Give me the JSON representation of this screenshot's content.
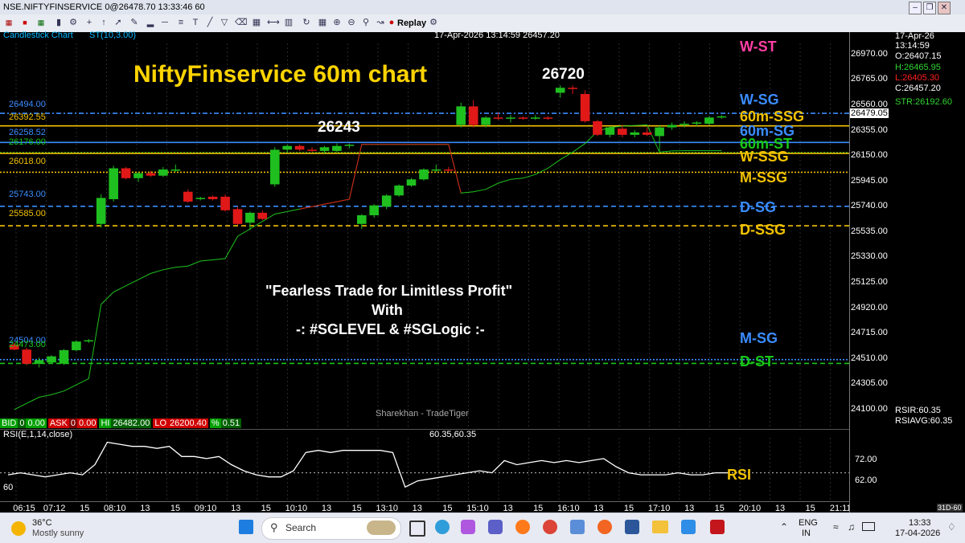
{
  "window": {
    "title": "NSE.NIFTYFINSERVICE 0@26478.70 13:33:46 60"
  },
  "toolbar": {
    "replay_label": "Replay"
  },
  "chart_header": {
    "type_label": "Candlestick Chart",
    "indicator_label": "ST(10,3.00)",
    "datetime_info": "17-Apr-2026 13:14:59 26457.20"
  },
  "overlay": {
    "title": "NiftyFinservice 60m chart",
    "high_label": "26720",
    "swing_label": "26243",
    "slogan_1": "\"Fearless Trade for Limitless Profit\"",
    "slogan_2": "With",
    "slogan_3": "-: #SGLEVEL & #SGLogic :-",
    "watermark": "Sharekhan - TradeTiger"
  },
  "info_panel": {
    "date": "17-Apr-26",
    "time": "13:14:59",
    "open": "O:26407.15",
    "high": "H:26465.95",
    "low": "L:26405.30",
    "close": "C:26457.20",
    "str": "STR:26192.60"
  },
  "quote_bar": {
    "bid_label": "BID",
    "bid_qty": "0",
    "bid_price": "0.00",
    "ask_label": "ASK",
    "ask_qty": "0",
    "ask_price": "0.00",
    "hi_label": "HI",
    "hi_value": "26482.00",
    "lo_label": "LO",
    "lo_value": "26200.40",
    "pct_label": "%",
    "pct_value": "0.51"
  },
  "rsi_panel": {
    "title": "RSI(E,1,14,close)",
    "values_text": "60.35,60.35",
    "rsir": "RSIR:60.35",
    "rsiavg": "RSIAVG:60.35",
    "tick_72": "72.00",
    "tick_62": "62.00",
    "left_level": "60",
    "annotation": "RSI",
    "corner": "31D-60"
  },
  "price_axis_ticks": [
    "26970.00",
    "26765.00",
    "26560.00",
    "26355.00",
    "26150.00",
    "25945.00",
    "25740.00",
    "25535.00",
    "25330.00",
    "25125.00",
    "24920.00",
    "24715.00",
    "24510.00",
    "24305.00",
    "24100.00"
  ],
  "current_price_tag": "26479.05",
  "x_axis": {
    "labels": [
      "06:15",
      "07:12",
      "15",
      "08:10",
      "13",
      "15",
      "09:10",
      "13",
      "15",
      "10:10",
      "13",
      "15",
      "13:10",
      "13",
      "15",
      "15:10",
      "13",
      "15",
      "16:10",
      "13",
      "15",
      "17:10",
      "13",
      "15",
      "20:10",
      "13",
      "15",
      "21:11"
    ]
  },
  "levels": [
    {
      "label": "W-ST",
      "value_text": "",
      "color": "#ff3fa4"
    },
    {
      "label": "W-SG",
      "value_text": "26494.00",
      "color": "#3a8cff"
    },
    {
      "label": "60m-SSG",
      "value_text": "26392.55",
      "color": "#f2c200"
    },
    {
      "label": "60m-SG",
      "value_text": "26258.52",
      "color": "#3a8cff"
    },
    {
      "label": "60m-ST",
      "value_text": "26176.00",
      "color": "#18c718"
    },
    {
      "label": "W-SSG",
      "value_text": "",
      "color": "#f2c200"
    },
    {
      "label": "M-SSG",
      "value_text": "26018.00",
      "color": "#f2c200"
    },
    {
      "label": "D-SG",
      "value_text": "25743.00",
      "color": "#3a8cff"
    },
    {
      "label": "D-SSG",
      "value_text": "25585.00",
      "color": "#f2c200"
    },
    {
      "label": "M-SG",
      "value_text": "24504.00",
      "color": "#3a8cff"
    },
    {
      "label": "D-ST",
      "value_text": "24473.00",
      "color": "#18c718"
    }
  ],
  "taskbar": {
    "weather_temp": "36°C",
    "weather_desc": "Mostly sunny",
    "search_placeholder": "Search",
    "lang_1": "ENG",
    "lang_2": "IN",
    "clock_time": "13:33",
    "clock_date": "17-04-2026"
  },
  "chart_data": {
    "type": "candlestick",
    "y_range": [
      23950,
      27150
    ],
    "x_labels": [
      "06:15",
      "07:12",
      "15",
      "08:10",
      "13",
      "15",
      "09:10",
      "13",
      "15",
      "10:10",
      "13",
      "15",
      "13:10",
      "13",
      "15",
      "15:10",
      "13",
      "15",
      "16:10",
      "13",
      "15",
      "17:10",
      "13",
      "15",
      "20:10",
      "13",
      "15",
      "21:11"
    ],
    "candles": [
      {
        "o": 24625,
        "h": 24640,
        "l": 24580,
        "c": 24585
      },
      {
        "o": 24585,
        "h": 24600,
        "l": 24460,
        "c": 24470
      },
      {
        "o": 24470,
        "h": 24520,
        "l": 24440,
        "c": 24500
      },
      {
        "o": 24480,
        "h": 24540,
        "l": 24470,
        "c": 24530
      },
      {
        "o": 24470,
        "h": 24590,
        "l": 24460,
        "c": 24580
      },
      {
        "o": 24580,
        "h": 24660,
        "l": 24570,
        "c": 24650
      },
      {
        "o": 24650,
        "h": 24670,
        "l": 24640,
        "c": 24660
      },
      {
        "o": 25600,
        "h": 25840,
        "l": 25570,
        "c": 25810
      },
      {
        "o": 25800,
        "h": 26070,
        "l": 25780,
        "c": 26050
      },
      {
        "o": 26050,
        "h": 26060,
        "l": 25960,
        "c": 25970
      },
      {
        "o": 25970,
        "h": 26020,
        "l": 25940,
        "c": 26010
      },
      {
        "o": 26010,
        "h": 26030,
        "l": 25980,
        "c": 25990
      },
      {
        "o": 25990,
        "h": 26060,
        "l": 25980,
        "c": 26040
      },
      {
        "o": 26040,
        "h": 26080,
        "l": 26020,
        "c": 26040
      },
      {
        "o": 25860,
        "h": 25880,
        "l": 25770,
        "c": 25780
      },
      {
        "o": 25800,
        "h": 25820,
        "l": 25790,
        "c": 25810
      },
      {
        "o": 25820,
        "h": 25830,
        "l": 25790,
        "c": 25800
      },
      {
        "o": 25820,
        "h": 25840,
        "l": 25700,
        "c": 25710
      },
      {
        "o": 25720,
        "h": 25740,
        "l": 25590,
        "c": 25600
      },
      {
        "o": 25610,
        "h": 25700,
        "l": 25550,
        "c": 25690
      },
      {
        "o": 25690,
        "h": 25710,
        "l": 25630,
        "c": 25640
      },
      {
        "o": 25920,
        "h": 26220,
        "l": 25900,
        "c": 26200
      },
      {
        "o": 26200,
        "h": 26240,
        "l": 26180,
        "c": 26230
      },
      {
        "o": 26230,
        "h": 26243,
        "l": 26190,
        "c": 26200
      },
      {
        "o": 26200,
        "h": 26220,
        "l": 26180,
        "c": 26190
      },
      {
        "o": 26190,
        "h": 26230,
        "l": 26170,
        "c": 26220
      },
      {
        "o": 26190,
        "h": 26250,
        "l": 26180,
        "c": 26230
      },
      {
        "o": 26230,
        "h": 26250,
        "l": 26210,
        "c": 26240
      },
      {
        "o": 25600,
        "h": 25680,
        "l": 25560,
        "c": 25670
      },
      {
        "o": 25670,
        "h": 25760,
        "l": 25650,
        "c": 25750
      },
      {
        "o": 25740,
        "h": 25840,
        "l": 25720,
        "c": 25830
      },
      {
        "o": 25830,
        "h": 25920,
        "l": 25820,
        "c": 25910
      },
      {
        "o": 25910,
        "h": 25970,
        "l": 25900,
        "c": 25960
      },
      {
        "o": 25960,
        "h": 26050,
        "l": 25950,
        "c": 26040
      },
      {
        "o": 26040,
        "h": 26080,
        "l": 26020,
        "c": 26040
      },
      {
        "o": 26040,
        "h": 26060,
        "l": 26020,
        "c": 26030
      },
      {
        "o": 26400,
        "h": 26580,
        "l": 26380,
        "c": 26550
      },
      {
        "o": 26550,
        "h": 26600,
        "l": 26380,
        "c": 26400
      },
      {
        "o": 26400,
        "h": 26470,
        "l": 26380,
        "c": 26460
      },
      {
        "o": 26460,
        "h": 26500,
        "l": 26440,
        "c": 26450
      },
      {
        "o": 26450,
        "h": 26480,
        "l": 26420,
        "c": 26460
      },
      {
        "o": 26460,
        "h": 26470,
        "l": 26440,
        "c": 26450
      },
      {
        "o": 26450,
        "h": 26480,
        "l": 26440,
        "c": 26460
      },
      {
        "o": 26460,
        "h": 26470,
        "l": 26440,
        "c": 26450
      },
      {
        "o": 26660,
        "h": 26720,
        "l": 26620,
        "c": 26700
      },
      {
        "o": 26700,
        "h": 26720,
        "l": 26650,
        "c": 26690
      },
      {
        "o": 26650,
        "h": 26680,
        "l": 26420,
        "c": 26430
      },
      {
        "o": 26430,
        "h": 26440,
        "l": 26310,
        "c": 26320
      },
      {
        "o": 26320,
        "h": 26390,
        "l": 26300,
        "c": 26380
      },
      {
        "o": 26370,
        "h": 26400,
        "l": 26300,
        "c": 26320
      },
      {
        "o": 26320,
        "h": 26360,
        "l": 26300,
        "c": 26340
      },
      {
        "o": 26340,
        "h": 26380,
        "l": 26310,
        "c": 26320
      },
      {
        "o": 26310,
        "h": 26400,
        "l": 26180,
        "c": 26380
      },
      {
        "o": 26380,
        "h": 26420,
        "l": 26360,
        "c": 26400
      },
      {
        "o": 26400,
        "h": 26430,
        "l": 26380,
        "c": 26410
      },
      {
        "o": 26410,
        "h": 26430,
        "l": 26390,
        "c": 26420
      },
      {
        "o": 26410,
        "h": 26470,
        "l": 26400,
        "c": 26460
      },
      {
        "o": 26460,
        "h": 26480,
        "l": 26450,
        "c": 26470
      }
    ],
    "supertrend": [
      24100,
      24150,
      24200,
      24220,
      24250,
      24300,
      24350,
      24950,
      25050,
      25100,
      25150,
      25200,
      25230,
      25250,
      25260,
      25300,
      25310,
      25320,
      25500,
      25560,
      25620,
      25680,
      25700,
      25720,
      25740,
      25760,
      25780,
      25800,
      26243,
      26243,
      26243,
      26243,
      26243,
      26243,
      26243,
      26243,
      25850,
      25860,
      25880,
      25930,
      25960,
      25970,
      26000,
      26050,
      26120,
      26180,
      26250,
      26350,
      26380,
      26390,
      26395,
      26400,
      26180,
      26190,
      26192,
      26192,
      26192,
      26192
    ],
    "rsi_range": [
      50,
      80
    ],
    "rsi": [
      61,
      62,
      61,
      60,
      61,
      62,
      61,
      66,
      77,
      76,
      75,
      75,
      74,
      75,
      70,
      70,
      69,
      70,
      66,
      63,
      61,
      60,
      60,
      63,
      72,
      73,
      72,
      73,
      73,
      73,
      73,
      72,
      55,
      58,
      59,
      60,
      61,
      62,
      63,
      62,
      68,
      66,
      67,
      68,
      67,
      68,
      67,
      68,
      69,
      65,
      62,
      61,
      61,
      61,
      62,
      61,
      61,
      62,
      62
    ],
    "horizontal_levels": [
      {
        "value": 26494,
        "color": "#3a8cff",
        "style": "dashdot"
      },
      {
        "value": 26392.55,
        "color": "#f2c200",
        "style": "solid"
      },
      {
        "value": 26258.52,
        "color": "#3a8cff",
        "style": "solid"
      },
      {
        "value": 26176,
        "color": "#18c718",
        "style": "dotted"
      },
      {
        "value": 26170,
        "color": "#f2c200",
        "style": "solid"
      },
      {
        "value": 26018,
        "color": "#f2c200",
        "style": "dotted"
      },
      {
        "value": 25743,
        "color": "#3a8cff",
        "style": "dashed"
      },
      {
        "value": 25585,
        "color": "#f2c200",
        "style": "dashed"
      },
      {
        "value": 24504,
        "color": "#3a8cff",
        "style": "dotted"
      },
      {
        "value": 24473,
        "color": "#18c718",
        "style": "dashed"
      }
    ]
  }
}
